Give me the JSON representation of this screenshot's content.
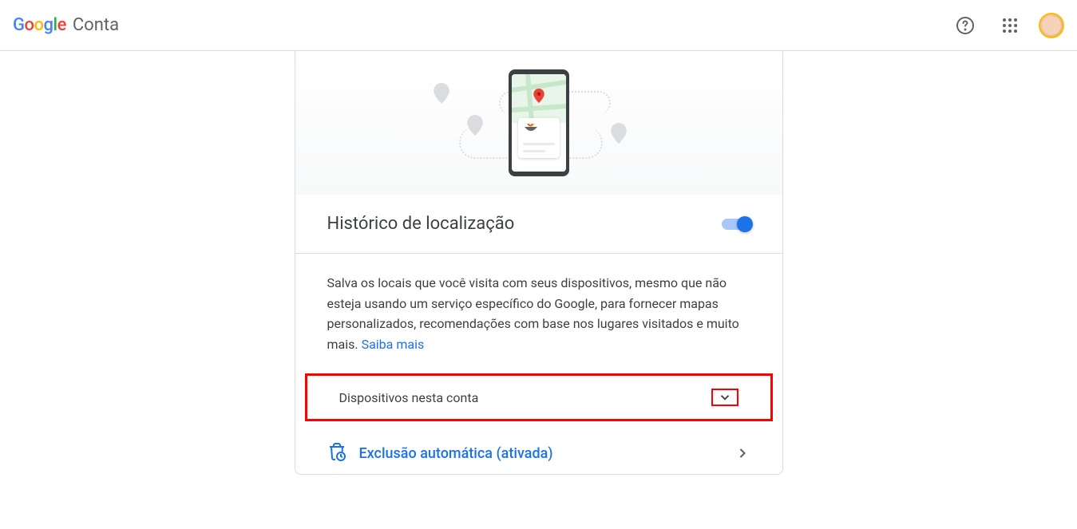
{
  "header": {
    "logo_brand": "Google",
    "account_label": "Conta"
  },
  "section": {
    "title": "Histórico de localização",
    "toggle_on": true
  },
  "description": {
    "text": "Salva os locais que você visita com seus dispositivos, mesmo que não esteja usando um serviço específico do Google, para fornecer mapas personalizados, recomendações com base nos lugares visitados e muito mais. ",
    "learn_more": "Saiba mais"
  },
  "devices": {
    "title": "Dispositivos nesta conta"
  },
  "auto_delete": {
    "label": "Exclusão automática (ativada)"
  }
}
